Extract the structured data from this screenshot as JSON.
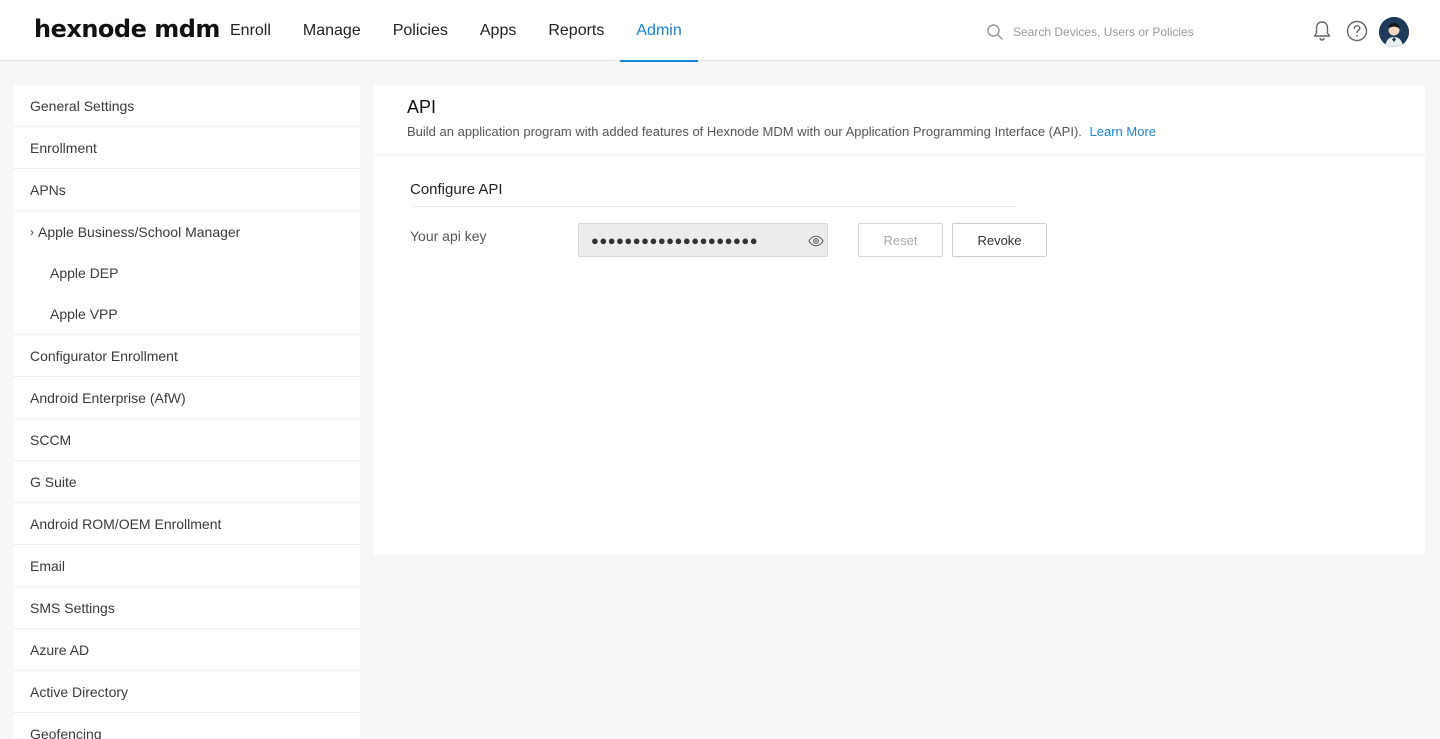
{
  "header": {
    "logo": "hexnode mdm",
    "nav": [
      {
        "label": "Enroll",
        "active": false
      },
      {
        "label": "Manage",
        "active": false
      },
      {
        "label": "Policies",
        "active": false
      },
      {
        "label": "Apps",
        "active": false
      },
      {
        "label": "Reports",
        "active": false
      },
      {
        "label": "Admin",
        "active": true
      }
    ],
    "search_placeholder": "Search Devices, Users or Policies",
    "icons": [
      "search-icon",
      "bell-icon",
      "help-icon",
      "avatar"
    ],
    "accent_color": "#1a82d6"
  },
  "sidebar": {
    "items": [
      {
        "label": "General Settings"
      },
      {
        "label": "Enrollment"
      },
      {
        "label": "APNs"
      },
      {
        "label": "Apple Business/School Manager",
        "expandable": true,
        "chevron": "›"
      },
      {
        "label": "Apple DEP",
        "sub": true
      },
      {
        "label": "Apple VPP",
        "sub": true
      },
      {
        "label": "Configurator Enrollment"
      },
      {
        "label": "Android Enterprise (AfW)"
      },
      {
        "label": "SCCM"
      },
      {
        "label": "G Suite"
      },
      {
        "label": "Android ROM/OEM Enrollment"
      },
      {
        "label": "Email"
      },
      {
        "label": "SMS Settings"
      },
      {
        "label": "Azure AD"
      },
      {
        "label": "Active Directory"
      },
      {
        "label": "Geofencing"
      }
    ]
  },
  "main": {
    "title": "API",
    "description": "Build an application program with added features of Hexnode MDM with our Application Programming Interface (API).",
    "learn_more": "Learn More",
    "section_title": "Configure API",
    "api_key_label": "Your api key",
    "api_key_masked": "●●●●●●●●●●●●●●●●●●●●",
    "reset_label": "Reset",
    "revoke_label": "Revoke"
  }
}
